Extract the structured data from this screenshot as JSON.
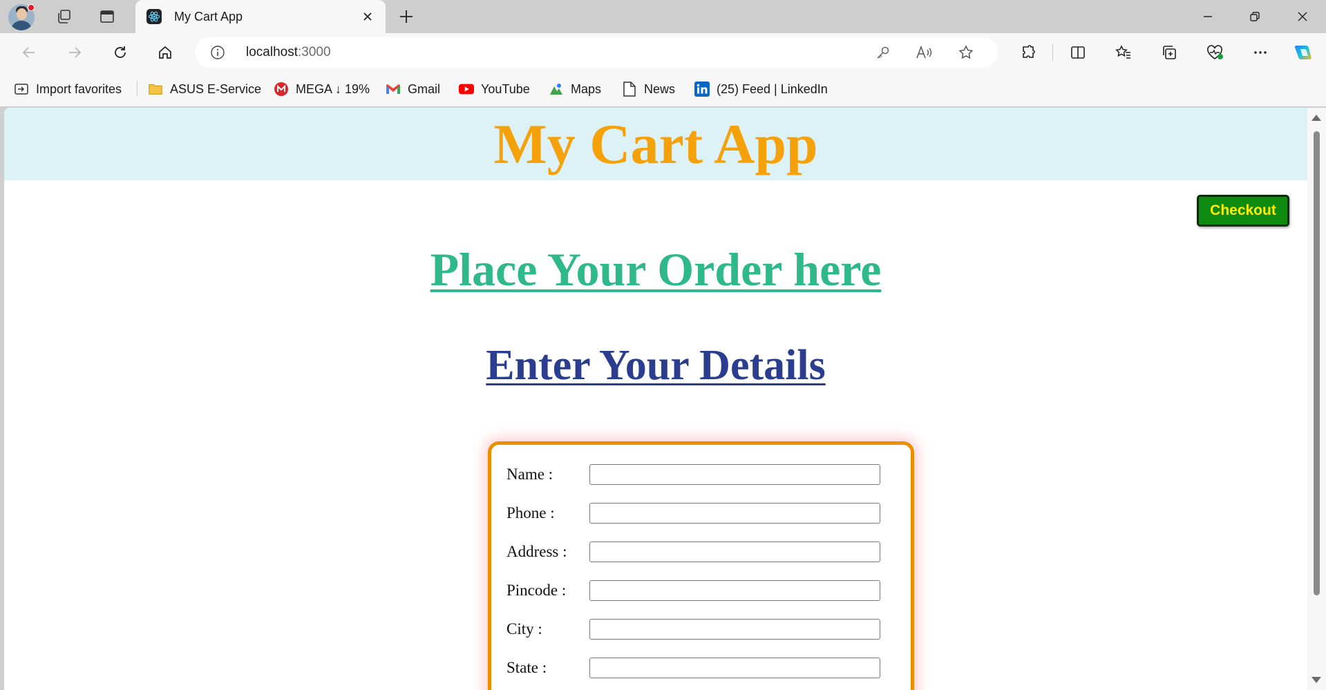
{
  "browser": {
    "tab_title": "My Cart App",
    "url_host": "localhost",
    "url_port": ":3000",
    "favorites": [
      {
        "label": "Import favorites",
        "icon": "import-favorites-icon"
      },
      {
        "label": "ASUS E-Service",
        "icon": "folder-icon"
      },
      {
        "label": "MEGA ↓ 19%",
        "icon": "mega-icon"
      },
      {
        "label": "Gmail",
        "icon": "gmail-icon"
      },
      {
        "label": "YouTube",
        "icon": "youtube-icon"
      },
      {
        "label": "Maps",
        "icon": "maps-icon"
      },
      {
        "label": "News",
        "icon": "news-icon"
      },
      {
        "label": "(25) Feed | LinkedIn",
        "icon": "linkedin-icon"
      }
    ]
  },
  "page": {
    "header_title": "My Cart App",
    "checkout_label": "Checkout",
    "order_heading": "Place Your Order here",
    "details_heading": "Enter Your Details",
    "form": {
      "fields": [
        {
          "label": "Name :",
          "value": ""
        },
        {
          "label": "Phone :",
          "value": ""
        },
        {
          "label": "Address :",
          "value": ""
        },
        {
          "label": "Pincode :",
          "value": ""
        },
        {
          "label": "City :",
          "value": ""
        },
        {
          "label": "State :",
          "value": ""
        }
      ]
    }
  },
  "colors": {
    "header_bg": "#dcf2f7",
    "header_text": "#f5a20a",
    "order_heading": "#2fb889",
    "details_heading": "#2a3d8f",
    "checkout_bg": "#0e8a0e",
    "checkout_text": "#ffee00",
    "form_border": "#e89000"
  }
}
